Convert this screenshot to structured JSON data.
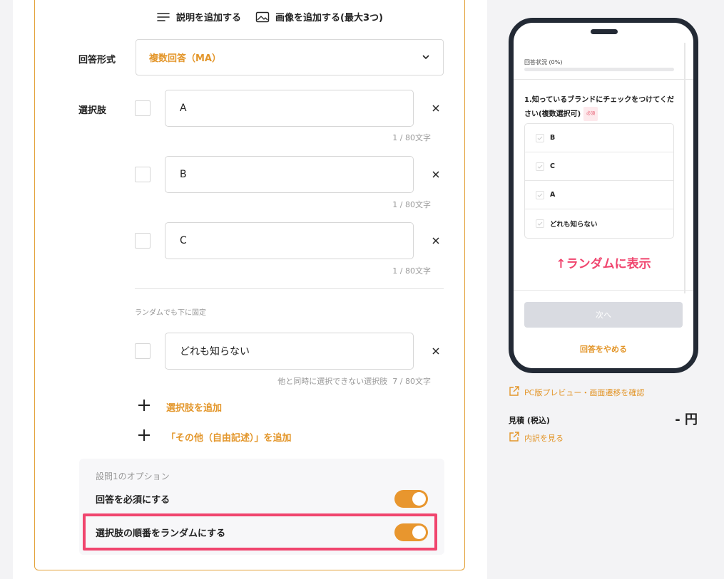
{
  "editor": {
    "add_description": "説明を追加する",
    "add_image": "画像を追加する(最大3つ)",
    "answer_format_label": "回答形式",
    "answer_format_value": "複数回答（MA）",
    "choices_label": "選択肢",
    "choices": [
      {
        "text": "A",
        "counter": "1 / 80文字"
      },
      {
        "text": "B",
        "counter": "1 / 80文字"
      },
      {
        "text": "C",
        "counter": "1 / 80文字"
      }
    ],
    "fixed_section_label": "ランダムでも下に固定",
    "fixed_choice": {
      "text": "どれも知らない",
      "note": "他と同時に選択できない選択肢",
      "counter": "7 / 80文字"
    },
    "add_choice": "選択肢を追加",
    "add_other": "「その他（自由記述）」を追加",
    "options_title": "設問1のオプション",
    "option_required": "回答を必須にする",
    "option_required_on": true,
    "option_random": "選択肢の順番をランダムにする",
    "option_random_on": true
  },
  "preview": {
    "progress_label": "回答状況 (0%)",
    "progress_fraction": 0,
    "question_title": "1.知っているブランドにチェックをつけてください(複数選択可)",
    "required_badge": "必須",
    "choices": [
      "B",
      "C",
      "A",
      "どれも知らない"
    ],
    "random_note": "↑ランダムに表示",
    "next_button": "次へ",
    "quit_link": "回答をやめる"
  },
  "sidebar": {
    "pc_preview_link": "PC版プレビュー・画面遷移を確認",
    "estimate_label": "見積 (税込)",
    "estimate_value": "- 円",
    "breakdown_link": "内訳を見る"
  },
  "colors": {
    "accent": "#e3962a",
    "highlight": "#f0456e",
    "toggle_on": "#e8962e",
    "phone_frame": "#232a35"
  }
}
